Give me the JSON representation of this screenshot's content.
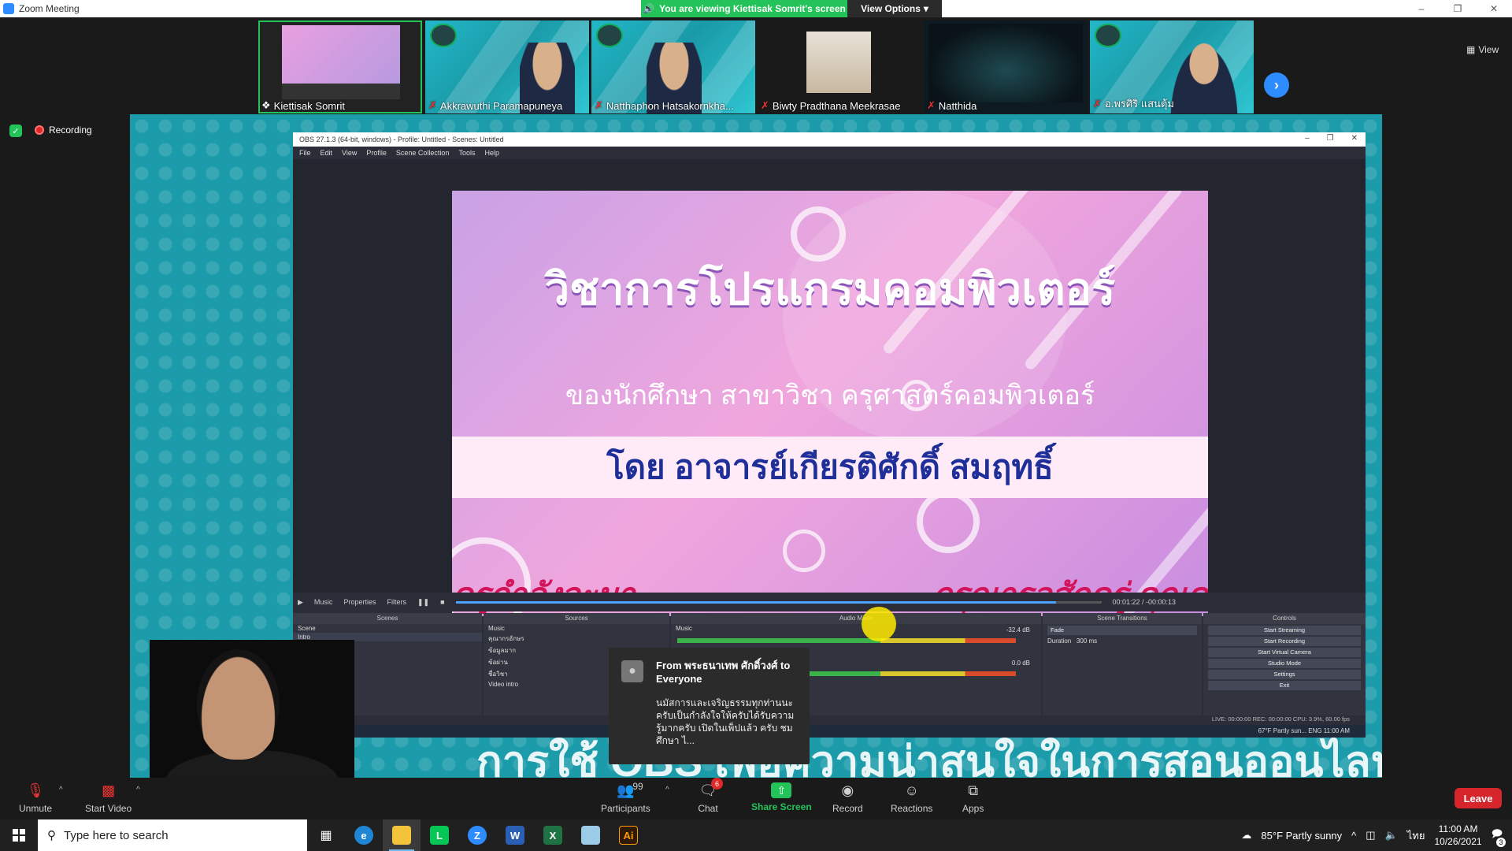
{
  "window": {
    "title": "Zoom Meeting",
    "viewing_banner": "You are viewing Kiettisak Somrit's screen",
    "view_options": "View Options"
  },
  "gallery": {
    "participants": [
      {
        "name": "Kiettisak Somrit"
      },
      {
        "name": "Akkrawuthi Paramapuneya"
      },
      {
        "name": "Natthaphon Hatsakornkha..."
      },
      {
        "name": "Biwty Pradthana Meekrasae"
      },
      {
        "name": "Natthida"
      },
      {
        "name": "อ.พรศิริ แสนตุ้ม"
      }
    ],
    "view_label": "View"
  },
  "status": {
    "recording": "Recording"
  },
  "obs": {
    "title": "OBS 27.1.3 (64-bit, windows) - Profile: Untitled - Scenes: Untitled",
    "menu": [
      "File",
      "Edit",
      "View",
      "Profile",
      "Scene Collection",
      "Tools",
      "Help"
    ],
    "source_name": "Music",
    "properties": "Properties",
    "filters": "Filters",
    "time": "00:01:22 / -00:00:13",
    "seek_fraction": 0.93,
    "docks": {
      "scenes": {
        "title": "Scenes",
        "items": [
          "Scene",
          "Intro"
        ]
      },
      "sources": {
        "title": "Sources",
        "items": [
          "Music",
          "คุณากรอักษร",
          "ข้อมูลมาก",
          "ข้อผ่าน",
          "ชื่อวิชา",
          "Video intro"
        ]
      },
      "audio": {
        "title": "Audio Mixer",
        "row1": "Music",
        "db1": "-32.4 dB",
        "db2": "0.0 dB"
      },
      "transitions": {
        "title": "Scene Transitions",
        "value": "Fade",
        "duration_label": "Duration",
        "duration": "300 ms"
      },
      "controls": {
        "title": "Controls",
        "buttons": [
          "Start Streaming",
          "Start Recording",
          "Start Virtual Camera",
          "Studio Mode",
          "Settings",
          "Exit"
        ]
      }
    },
    "statusbar": "LIVE: 00:00:00   REC: 00:00:00   CPU: 3.9%, 60.00 fps",
    "inner_taskbar": "67°F  Partly sun...   ENG   11:00 AM"
  },
  "slide": {
    "title": "วิชาการโปรแกรมคอมพิวเตอร์",
    "subtitle": "ของนักศึกษา สาขาวิชา ครุศาสตร์คอมพิวเตอร์",
    "by": "โดย อาจารย์เกียรติศักดิ์ สมฤทธิ์",
    "marquee_left": "ครูกำลังจะมา...",
    "marquee_right": "กรุณารอสักครู่ คุณค"
  },
  "shared_bottom_text": "การใช้ OBS เพื่อความน่าสนใจในการสอนออนไลน์",
  "chat_toast": {
    "from": "From พระธนาเทพ ศักดิ์วงศ์ to Everyone",
    "message": "นมัสการและเจริญธรรมทุกท่านนะครับเป็นกำลังใจให้ครับได้รับความรู้มากครับ เปิดในเพ็ปแล้ว ครับ ชมศึกษา ไ..."
  },
  "toolbar": {
    "unmute": "Unmute",
    "start_video": "Start Video",
    "participants": "Participants",
    "participants_count": "99",
    "chat": "Chat",
    "chat_badge": "6",
    "share_screen": "Share Screen",
    "record": "Record",
    "reactions": "Reactions",
    "apps": "Apps",
    "leave": "Leave"
  },
  "taskbar": {
    "search_placeholder": "Type here to search",
    "weather": "85°F  Partly sunny",
    "lang": "ไทย",
    "time": "11:00 AM",
    "date": "10/26/2021",
    "notif_count": "3"
  },
  "colors": {
    "zoom_green": "#23c35a",
    "zoom_blue": "#2d8cff",
    "leave_red": "#d6262b"
  }
}
